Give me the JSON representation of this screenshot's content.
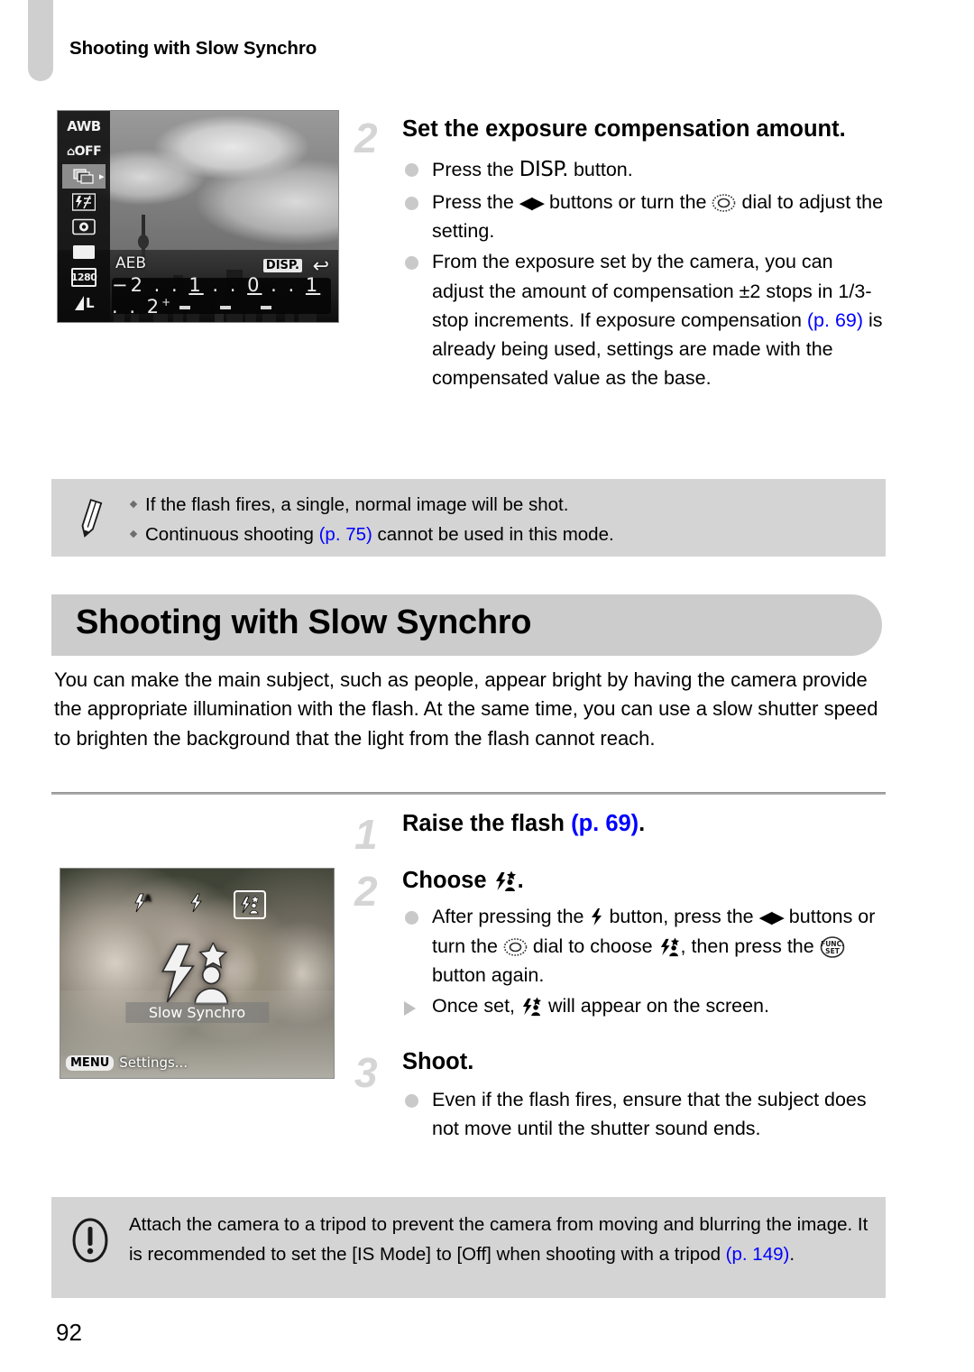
{
  "page": {
    "running_header": "Shooting with Slow Synchro",
    "folio": "92",
    "link_color": "#0000ff",
    "band_color": "#cccccc",
    "callout_color": "#d4d4d4"
  },
  "top_section": {
    "screenshot": {
      "name": "aeb-exposure-screen",
      "func_menu": [
        "AWB",
        "OFF",
        "aeb-bracket-icon",
        "flash-exposure-comp-icon",
        "metering-icon",
        "aspect-ratio-icon",
        "1280",
        "L"
      ],
      "selected_index": 2,
      "overlay_label": "AEB",
      "disp_chip": "DISP.",
      "return_icon": "return-arrow-icon",
      "exposure_scale": "-2 . . 1 . . 0 . . 1 . . 2+",
      "scale_minus": "−2",
      "scale_plus": "2",
      "scale_marks": [
        "1",
        "0",
        "1"
      ]
    },
    "step": {
      "number": "2",
      "title": "Set the exposure compensation amount.",
      "bullets": [
        {
          "type": "dot",
          "parts": [
            {
              "t": "Press the "
            },
            {
              "t": "DISP.",
              "style": "camera-glyph"
            },
            {
              "t": " button."
            }
          ]
        },
        {
          "type": "dot",
          "parts": [
            {
              "t": "Press the "
            },
            {
              "t": "◀▶",
              "style": "glyph"
            },
            {
              "t": " buttons or turn the "
            },
            {
              "t": "control-dial-icon",
              "style": "icon"
            },
            {
              "t": " dial to adjust the setting."
            }
          ]
        },
        {
          "type": "dot",
          "parts": [
            {
              "t": "From the exposure set by the camera, you can adjust the amount of compensation ±2 stops in 1/3-stop increments. If exposure compensation "
            },
            {
              "t": "(p. 69)",
              "style": "ref"
            },
            {
              "t": " is already being used, settings are made with the compensated value as the base."
            }
          ]
        }
      ]
    },
    "note_box": {
      "icon": "pencil-icon",
      "items": [
        {
          "parts": [
            {
              "t": "If the flash fires, a single, normal image will be shot."
            }
          ]
        },
        {
          "parts": [
            {
              "t": "Continuous shooting "
            },
            {
              "t": "(p. 75)",
              "style": "ref"
            },
            {
              "t": " cannot be used in this mode."
            }
          ]
        }
      ]
    }
  },
  "main_section": {
    "heading": "Shooting with Slow Synchro",
    "intro": "You can make the main subject, such as people, appear bright by having the camera provide the appropriate illumination with the flash. At the same time, you can use a slow shutter speed to brighten the background that the light from the flash cannot reach.",
    "screenshot": {
      "name": "slow-synchro-flash-screen",
      "flash_options": [
        "flash-auto-icon",
        "flash-on-icon",
        "slow-synchro-icon"
      ],
      "selected_option": 2,
      "mode_name": "Slow Synchro",
      "menu_chip": "MENU",
      "menu_label": "Settings..."
    },
    "steps": [
      {
        "number": "1",
        "title_parts": [
          {
            "t": "Raise the flash "
          },
          {
            "t": "(p. 69)",
            "style": "ref"
          },
          {
            "t": "."
          }
        ],
        "bullets": []
      },
      {
        "number": "2",
        "title_parts": [
          {
            "t": "Choose "
          },
          {
            "t": "slow-synchro-icon",
            "style": "icon"
          },
          {
            "t": "."
          }
        ],
        "bullets": [
          {
            "type": "dot",
            "parts": [
              {
                "t": "After pressing the "
              },
              {
                "t": "flash-icon",
                "style": "icon"
              },
              {
                "t": " button, press the "
              },
              {
                "t": "◀▶",
                "style": "glyph"
              },
              {
                "t": " buttons or turn the "
              },
              {
                "t": "control-dial-icon",
                "style": "icon"
              },
              {
                "t": " dial to choose "
              },
              {
                "t": "slow-synchro-icon",
                "style": "icon"
              },
              {
                "t": ", then press the "
              },
              {
                "t": "func-set-icon",
                "style": "icon"
              },
              {
                "t": " button again."
              }
            ]
          },
          {
            "type": "triangle",
            "parts": [
              {
                "t": "Once set, "
              },
              {
                "t": "slow-synchro-icon",
                "style": "icon"
              },
              {
                "t": " will appear on the screen."
              }
            ]
          }
        ]
      },
      {
        "number": "3",
        "title_parts": [
          {
            "t": "Shoot."
          }
        ],
        "bullets": [
          {
            "type": "dot",
            "parts": [
              {
                "t": "Even if the flash fires, ensure that the subject does not move until the shutter sound ends."
              }
            ]
          }
        ]
      }
    ],
    "caution_box": {
      "icon": "exclamation-icon",
      "parts": [
        {
          "t": "Attach the camera to a tripod to prevent the camera from moving and blurring the image. It is recommended to set the [IS Mode] to [Off] when shooting with a tripod "
        },
        {
          "t": "(p. 149)",
          "style": "ref"
        },
        {
          "t": "."
        }
      ]
    }
  }
}
